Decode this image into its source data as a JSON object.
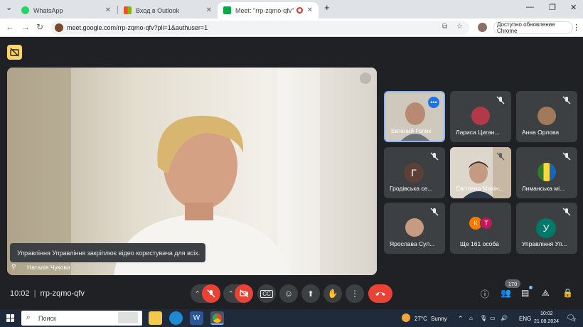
{
  "browser": {
    "tabs": [
      {
        "label": "WhatsApp",
        "icon": "whatsapp-icon",
        "color": "#25d366"
      },
      {
        "label": "Вход в Outlook",
        "icon": "microsoft-icon",
        "color": "#f25022"
      },
      {
        "label": "Meet: \"rrp-zqmo-qfv\"",
        "icon": "meet-icon",
        "color": "#00ac47"
      }
    ],
    "url": "meet.google.com/rrp-zqmo-qfv?pli=1&authuser=1",
    "update_label": "Доступно обновление Chrome"
  },
  "meet": {
    "main_participant": "Наталія Чукова",
    "toast": "Управління Управління закріплює відео користувача для всіх.",
    "participants": [
      {
        "name": "Евгений Голик",
        "type": "video"
      },
      {
        "name": "Лариса Циган...",
        "type": "photo"
      },
      {
        "name": "Анна Орлова",
        "type": "photo"
      },
      {
        "name": "Гродівська се...",
        "type": "letter",
        "letter": "Г",
        "color": "#5d4037"
      },
      {
        "name": "Світлана Махін...",
        "type": "video"
      },
      {
        "name": "Лиманська мі...",
        "type": "photo"
      },
      {
        "name": "Ярослава Сул...",
        "type": "photo"
      },
      {
        "name": "Ще 161 особа",
        "type": "more",
        "letters": [
          "К",
          "Т"
        ]
      },
      {
        "name": "Управління Уп...",
        "type": "letter",
        "letter": "У",
        "color": "#00796b"
      }
    ],
    "time": "10:02",
    "meeting_code": "rrp-zqmo-qfv",
    "people_count": "170"
  },
  "taskbar": {
    "search_placeholder": "Поиск",
    "weather_temp": "27°C",
    "weather_text": "Sunny",
    "language": "ENG",
    "clock_time": "10:02",
    "clock_date": "21.08.2024",
    "notification_count": "2"
  },
  "colors": {
    "meet_bg": "#202124",
    "tile_bg": "#3c4043",
    "danger": "#ea4335",
    "accent": "#8ab4f8"
  }
}
